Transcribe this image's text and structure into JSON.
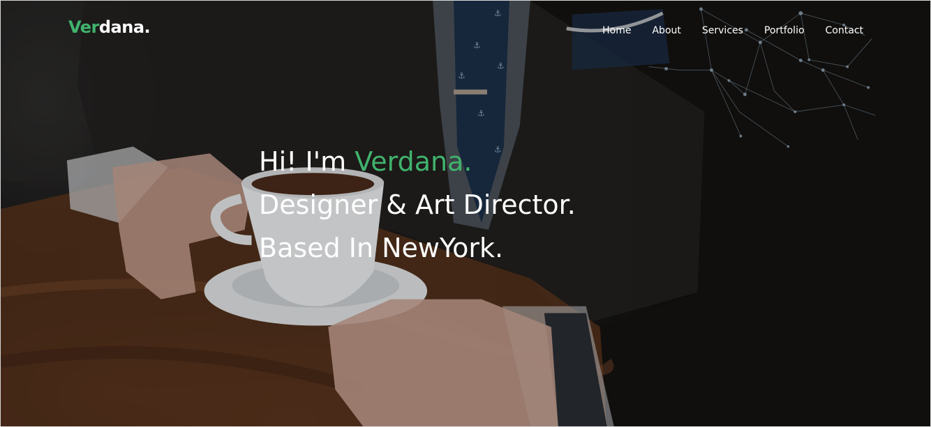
{
  "brand": {
    "logo_part1": "Ver",
    "logo_part2": "dana.",
    "accent_color": "#40b36d"
  },
  "nav": {
    "items": [
      {
        "label": "Home"
      },
      {
        "label": "About"
      },
      {
        "label": "Services"
      },
      {
        "label": "Portfolio"
      },
      {
        "label": "Contact"
      }
    ]
  },
  "hero": {
    "greeting_prefix": "Hi! I'm ",
    "greeting_name": "Verdana.",
    "line2": "Designer & Art Director.",
    "line3": "Based In NewYork.",
    "background_image": "businessman-with-coffee-cup-photo"
  }
}
